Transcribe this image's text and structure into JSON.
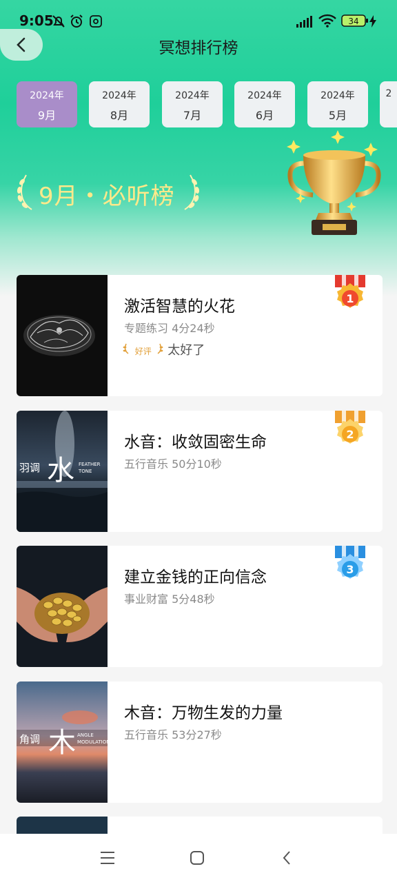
{
  "status": {
    "time": "9:05",
    "battery": "34"
  },
  "header": {
    "title": "冥想排行榜"
  },
  "tabs": [
    {
      "year": "2024年",
      "month": "9月",
      "active": true
    },
    {
      "year": "2024年",
      "month": "8月"
    },
    {
      "year": "2024年",
      "month": "7月"
    },
    {
      "year": "2024年",
      "month": "6月"
    },
    {
      "year": "2024年",
      "month": "5月"
    },
    {
      "year": "2",
      "month": ""
    }
  ],
  "banner": {
    "text": "9月・必听榜"
  },
  "items": [
    {
      "title": "激活智慧的火花",
      "subtitle": "专题练习 4分24秒",
      "review_tag": "好评",
      "review_text": "太好了",
      "rank": "1",
      "rank_color": "#f04a2e",
      "ribbon_color": "#e43a2f"
    },
    {
      "title": "水音：收敛固密生命",
      "subtitle": "五行音乐 50分10秒",
      "rank": "2",
      "rank_color": "#f5a623",
      "ribbon_color": "#f0a030",
      "thumb_text": "羽调",
      "thumb_big": "水",
      "thumb_en1": "FEATHER",
      "thumb_en2": "TONE"
    },
    {
      "title": "建立金钱的正向信念",
      "subtitle": "事业财富 5分48秒",
      "rank": "3",
      "rank_color": "#2a9de8",
      "ribbon_color": "#2a8fe0"
    },
    {
      "title": "木音：万物生发的力量",
      "subtitle": "五行音乐 53分27秒",
      "thumb_text": "角调",
      "thumb_big": "木",
      "thumb_en1": "ANGLE",
      "thumb_en2": "MODULATION"
    }
  ],
  "colors": {
    "accent": "#a98dc9",
    "bg_top": "#2fd39e"
  },
  "icons": [
    "mute-bell-icon",
    "alarm-icon",
    "settings-icon",
    "signal-icon",
    "wifi-icon",
    "battery-icon",
    "charging-icon",
    "back-icon",
    "menu-nav-icon",
    "home-nav-icon",
    "back-nav-icon"
  ]
}
